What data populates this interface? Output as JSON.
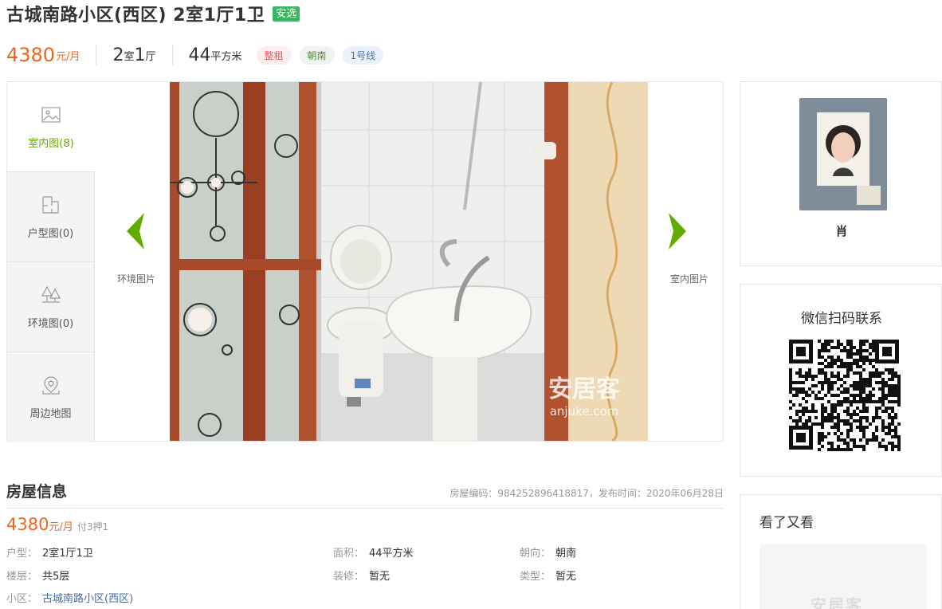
{
  "listing": {
    "title": "古城南路小区(西区) 2室1厅1卫",
    "badge": "安选"
  },
  "summary": {
    "price": "4380",
    "price_unit": "元/月",
    "rooms_num1": "2",
    "rooms_unit1": "室",
    "rooms_num2": "1",
    "rooms_unit2": "厅",
    "area_num": "44",
    "area_unit": "平方米",
    "tags": [
      "整租",
      "朝南",
      "1号线"
    ]
  },
  "gallery": {
    "tabs": [
      {
        "label": "室内图(8)",
        "icon": "image-icon",
        "active": true
      },
      {
        "label": "户型图(0)",
        "icon": "floorplan-icon",
        "active": false
      },
      {
        "label": "环境图(0)",
        "icon": "trees-icon",
        "active": false
      },
      {
        "label": "周边地图",
        "icon": "map-pin-icon",
        "active": false
      }
    ],
    "prev_caption": "环境图片",
    "next_caption": "室内图片",
    "watermark_brand": "安居客",
    "watermark_url": "anjuke.com"
  },
  "agent": {
    "name": "肖"
  },
  "wechat": {
    "title": "微信扫码联系"
  },
  "seen": {
    "title": "看了又看",
    "watermark": "安居客"
  },
  "info": {
    "heading": "房屋信息",
    "meta": "房屋编码：984252896418817，发布时间：2020年06月28日",
    "price": "4380",
    "price_unit": "元/月",
    "pay": "付3押1",
    "rows": [
      {
        "key": "户型：",
        "value": "2室1厅1卫"
      },
      {
        "key": "面积：",
        "value": "44平方米"
      },
      {
        "key": "朝向：",
        "value": "朝南"
      },
      {
        "key": "楼层：",
        "value": "共5层"
      },
      {
        "key": "装修：",
        "value": "暂无"
      },
      {
        "key": "类型：",
        "value": "暂无"
      },
      {
        "key": "小区：",
        "value": "古城南路小区(西区)"
      }
    ]
  },
  "colors": {
    "accent_price": "#f0641e",
    "badge_green": "#3cb563",
    "arrow_green": "#62ab00",
    "link_blue": "#3c6eb4"
  }
}
